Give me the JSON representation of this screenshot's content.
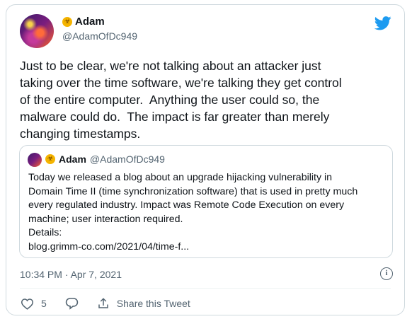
{
  "tweet": {
    "author": {
      "display_name": "Adam",
      "handle": "@AdamOfDc949",
      "badge_icon": "biohazard-icon"
    },
    "text": "Just to be clear, we're not talking about an attacker just\ntaking over the time software, we're talking they get control\nof the entire computer.  Anything the user could so, the\nmalware could do.  The impact is far greater than merely\nchanging timestamps.",
    "quote": {
      "author": {
        "display_name": "Adam",
        "handle": "@AdamOfDc949"
      },
      "text": "Today we released a blog about an upgrade hijacking vulnerability in\nDomain Time II (time synchronization software) that is used in pretty much\nevery regulated industry. Impact was Remote Code Execution on every\nmachine; user interaction required.\nDetails:\nblog.grimm-co.com/2021/04/time-f..."
    },
    "timestamp": "10:34 PM · Apr 7, 2021",
    "like_count": "5",
    "share_label": "Share this Tweet"
  },
  "colors": {
    "twitter_blue": "#1d9bf0",
    "secondary_text": "#536471",
    "border": "#cfd9de"
  }
}
